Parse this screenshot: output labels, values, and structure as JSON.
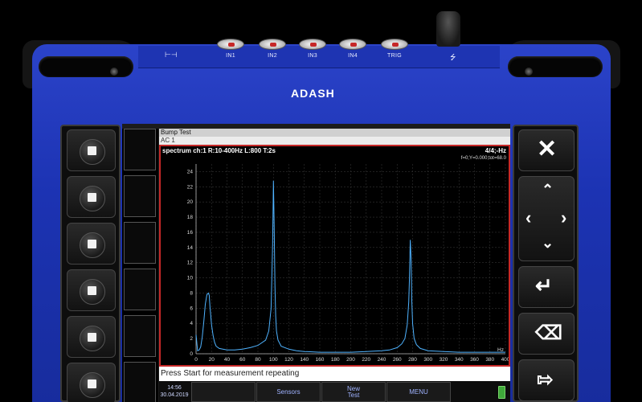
{
  "device": {
    "brand": "ADASH",
    "connectors": [
      "IN1",
      "IN2",
      "IN3",
      "IN4",
      "TRIG"
    ],
    "port_icon": "usb-icon",
    "knob_icon": "antenna-icon"
  },
  "left_keys": [
    "square-key-icon",
    "square-key-icon",
    "square-key-icon",
    "square-key-icon",
    "square-key-icon",
    "square-key-icon"
  ],
  "right_keys": [
    "close-icon",
    "arrow-pad-icon",
    "enter-icon",
    "backspace-icon",
    "forward-icon"
  ],
  "app": {
    "title": "Bump Test",
    "subtitle": "AC 1",
    "status": "Press Start for measurement repeating",
    "time": "14:56",
    "date": "30.04.2019",
    "menu": [
      "",
      "Sensors",
      "New Test",
      "MENU"
    ],
    "chart_header": "spectrum ch:1 R:10-400Hz L:800 T:2s",
    "chart_page": "4/4;-Hz",
    "chart_cursor": "f=0;Y=0.000;tot=68.0"
  },
  "colors": {
    "housing": "#1c33b3",
    "trace": "#4fb3ff",
    "frame": "#c62828"
  },
  "chart_data": {
    "type": "line",
    "xlabel": "Hz",
    "ylabel": "",
    "xlim": [
      0,
      400
    ],
    "ylim": [
      0,
      25
    ],
    "xticks": [
      0,
      20,
      40,
      60,
      80,
      100,
      120,
      140,
      160,
      180,
      200,
      220,
      240,
      260,
      280,
      300,
      320,
      340,
      360,
      380,
      400
    ],
    "yticks": [
      0,
      2,
      4,
      6,
      8,
      10,
      12,
      14,
      16,
      18,
      20,
      22,
      24
    ],
    "grid": true,
    "x": [
      0,
      2,
      4,
      6,
      8,
      10,
      12,
      14,
      16,
      17,
      18,
      20,
      22,
      24,
      26,
      30,
      40,
      50,
      60,
      70,
      80,
      90,
      94,
      97,
      99,
      100,
      101,
      102,
      103,
      104,
      106,
      110,
      120,
      130,
      140,
      160,
      180,
      200,
      220,
      240,
      250,
      260,
      266,
      270,
      273,
      275,
      276,
      277,
      278,
      279,
      280,
      282,
      285,
      290,
      300,
      320,
      340,
      360,
      380,
      400
    ],
    "y": [
      2.5,
      0.4,
      0.5,
      0.9,
      2.2,
      4.2,
      6.5,
      7.8,
      8.0,
      7.7,
      6.2,
      3.8,
      2.4,
      1.5,
      1.0,
      0.7,
      0.5,
      0.5,
      0.6,
      0.8,
      1.1,
      1.8,
      3.0,
      6.0,
      14.5,
      22.8,
      17.0,
      9.0,
      5.0,
      3.0,
      1.8,
      1.0,
      0.6,
      0.4,
      0.3,
      0.2,
      0.2,
      0.2,
      0.3,
      0.4,
      0.5,
      0.8,
      1.3,
      2.0,
      3.8,
      6.8,
      10.0,
      15.0,
      12.5,
      7.0,
      4.0,
      2.0,
      1.2,
      0.7,
      0.4,
      0.3,
      0.2,
      0.2,
      0.2,
      0.2
    ]
  }
}
